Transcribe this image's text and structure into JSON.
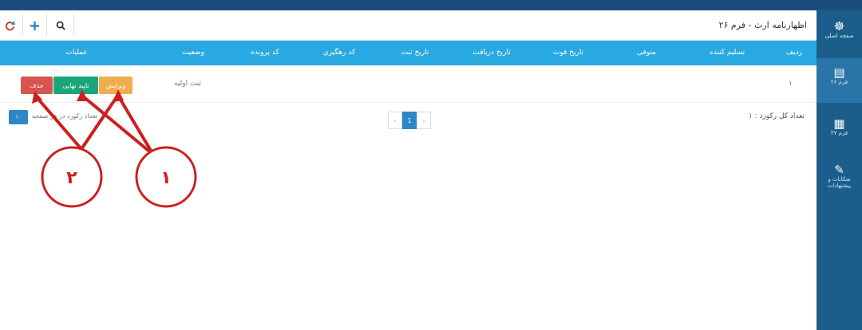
{
  "header": {
    "title": "اظهارنامه ارث - فرم ۲۶"
  },
  "toolbar": {
    "refresh_icon": "refresh-icon",
    "add_icon": "plus-icon",
    "search_icon": "search-icon"
  },
  "sidebar": {
    "items": [
      {
        "label": "صفحه اصلی",
        "icon": "dashboard-icon",
        "glyph": "☸"
      },
      {
        "label": "فرم ۲۶",
        "icon": "document-icon",
        "glyph": "▤"
      },
      {
        "label": "فرم ۳۷",
        "icon": "file-icon",
        "glyph": "▦"
      },
      {
        "label": "شکایات و پیشنهادات",
        "icon": "pen-icon",
        "glyph": "✎"
      }
    ]
  },
  "table": {
    "columns": [
      "ردیف",
      "تسلیم کننده",
      "متوفی",
      "تاریخ فوت",
      "تاریخ دریافت",
      "تاریخ ثبت",
      "کد رهگیری",
      "کد پرونده",
      "وضعیت",
      "عملیات"
    ],
    "rows": [
      {
        "index": "۱",
        "status": "ثبت اولیه",
        "actions": {
          "edit": "ویرایش",
          "confirm": "تایید نهایی",
          "delete": "حذف"
        }
      }
    ]
  },
  "footer": {
    "total_records": "تعداد کل رکورد : ۱",
    "per_page_label": "تعداد رکورد در هر صفحه",
    "per_page_value": "۱۰",
    "pagination": {
      "prev": "‹",
      "current": "1",
      "next": "›"
    }
  },
  "annotations": {
    "callout_1": "۱",
    "callout_2": "۲"
  },
  "colors": {
    "header_bar": "#29a9e1",
    "sidebar": "#1b5e8c",
    "edit": "#f0ad4e",
    "confirm": "#1aa67a",
    "delete": "#d9534f",
    "annotation": "#cc1f1f"
  }
}
